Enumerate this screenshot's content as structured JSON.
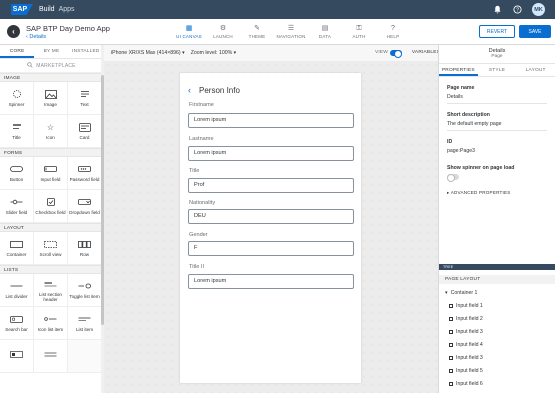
{
  "shell": {
    "logo": "SAP",
    "title": "Build",
    "subtitle": "Apps",
    "avatar": "MK",
    "icons": [
      "notification-icon",
      "help-icon"
    ]
  },
  "header": {
    "app_name": "SAP BTP Day Demo App",
    "page_link": "Details",
    "toolbar": [
      {
        "label": "UI CANVAS",
        "icon": "ui-canvas-icon",
        "active": true
      },
      {
        "label": "LAUNCH",
        "icon": "launch-icon",
        "active": false
      },
      {
        "label": "THEME",
        "icon": "theme-icon",
        "active": false
      },
      {
        "label": "NAVIGATION",
        "icon": "navigation-icon",
        "active": false
      },
      {
        "label": "DATA",
        "icon": "data-icon",
        "active": false
      },
      {
        "label": "AUTH",
        "icon": "auth-icon",
        "active": false
      },
      {
        "label": "HELP",
        "icon": "help-icon",
        "active": false
      }
    ],
    "revert_label": "REVERT",
    "save_label": "SAVE"
  },
  "left_panel": {
    "tabs": [
      {
        "label": "CORE",
        "active": true
      },
      {
        "label": "BY ME",
        "active": false
      },
      {
        "label": "INSTALLED",
        "active": false
      }
    ],
    "marketplace_label": "MARKETPLACE",
    "categories": [
      {
        "name": "IMAGE",
        "items": [
          {
            "label": "Spinner",
            "icon": "spinner-icon"
          },
          {
            "label": "Image",
            "icon": "image-icon"
          },
          {
            "label": "Text",
            "icon": "text-icon"
          },
          {
            "label": "Title",
            "icon": "title-icon"
          },
          {
            "label": "Icon",
            "icon": "star-icon"
          },
          {
            "label": "Card",
            "icon": "card-icon"
          }
        ]
      },
      {
        "name": "FORMS",
        "items": [
          {
            "label": "Button",
            "icon": "button-icon"
          },
          {
            "label": "Input field",
            "icon": "input-field-icon"
          },
          {
            "label": "Password field",
            "icon": "password-field-icon"
          },
          {
            "label": "Slider field",
            "icon": "slider-icon"
          },
          {
            "label": "Checkbox field",
            "icon": "checkbox-icon"
          },
          {
            "label": "Dropdown field",
            "icon": "dropdown-icon"
          }
        ]
      },
      {
        "name": "LAYOUT",
        "items": [
          {
            "label": "Container",
            "icon": "container-icon"
          },
          {
            "label": "Scroll view",
            "icon": "scroll-view-icon"
          },
          {
            "label": "Row",
            "icon": "row-icon"
          }
        ]
      },
      {
        "name": "LISTS",
        "items": [
          {
            "label": "List divider",
            "icon": "list-divider-icon"
          },
          {
            "label": "List section header",
            "icon": "list-section-header-icon"
          },
          {
            "label": "Toggle list item",
            "icon": "toggle-list-item-icon"
          },
          {
            "label": "Search bar",
            "icon": "search-bar-icon"
          },
          {
            "label": "Icon list item",
            "icon": "icon-list-item-icon"
          },
          {
            "label": "List item",
            "icon": "list-item-icon"
          },
          {
            "label": "",
            "icon": "list-extra-icon"
          },
          {
            "label": "",
            "icon": "list-extra-2-icon"
          }
        ]
      }
    ]
  },
  "canvas": {
    "device": "iPhone XR/XS Max (414×896)",
    "zoom": "Zoom level: 100%",
    "view_label": "VIEW",
    "variables_label": "VARIABLES",
    "page_title": "Person Info",
    "fields": [
      {
        "label": "Firstname",
        "value": "Lorem ipsum"
      },
      {
        "label": "Lastname",
        "value": "Lorem ipsum"
      },
      {
        "label": "Title",
        "value": "Prof"
      },
      {
        "label": "Nationality",
        "value": "DEU"
      },
      {
        "label": "Gender",
        "value": "F"
      },
      {
        "label": "Title II",
        "value": "Lorem ipsum"
      }
    ]
  },
  "right_panel": {
    "title": "Details",
    "subtitle": "Page",
    "tabs": [
      {
        "label": "PROPERTIES",
        "active": true
      },
      {
        "label": "STYLE",
        "active": false
      },
      {
        "label": "LAYOUT",
        "active": false
      }
    ],
    "page_name_label": "Page name",
    "page_name_value": "Details",
    "short_desc_label": "Short description",
    "short_desc_value": "The default empty page",
    "id_label": "ID",
    "id_value": "page:Page3",
    "spinner_label": "Show spinner on page load",
    "advanced_label": "ADVANCED PROPERTIES",
    "tree_label": "TREE",
    "page_layout_label": "PAGE LAYOUT",
    "tree": [
      {
        "label": "Container 1",
        "child": false
      },
      {
        "label": "Input field 1",
        "child": true
      },
      {
        "label": "Input field 2",
        "child": true
      },
      {
        "label": "Input field 3",
        "child": true
      },
      {
        "label": "Input field 4",
        "child": true
      },
      {
        "label": "Input field 3",
        "child": true
      },
      {
        "label": "Input field 5",
        "child": true
      },
      {
        "label": "Input field 6",
        "child": true
      }
    ]
  }
}
